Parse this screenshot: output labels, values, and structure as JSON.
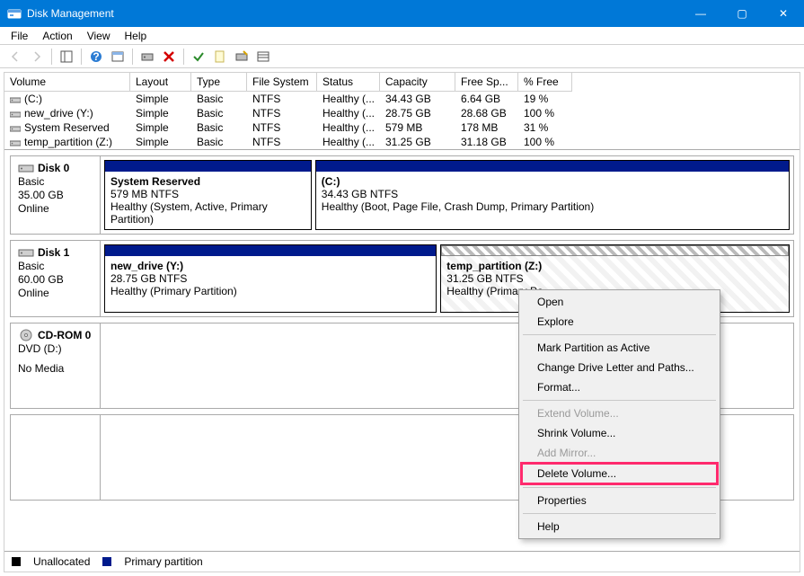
{
  "window": {
    "title": "Disk Management",
    "buttons": {
      "min": "—",
      "max": "▢",
      "close": "✕"
    }
  },
  "menus": [
    "File",
    "Action",
    "View",
    "Help"
  ],
  "toolbar_icons": [
    "back",
    "forward",
    "|",
    "show-hide",
    "|",
    "help-icon",
    "properties-icon",
    "|",
    "refresh-icon",
    "delete-icon",
    "|",
    "check-icon",
    "note-icon",
    "wizard-icon",
    "list-icon"
  ],
  "columns": {
    "volume": "Volume",
    "layout": "Layout",
    "type": "Type",
    "fs": "File System",
    "status": "Status",
    "capacity": "Capacity",
    "free": "Free Sp...",
    "pct": "% Free"
  },
  "volumes": [
    {
      "name": "(C:)",
      "layout": "Simple",
      "type": "Basic",
      "fs": "NTFS",
      "status": "Healthy (...",
      "capacity": "34.43 GB",
      "free": "6.64 GB",
      "pct": "19 %"
    },
    {
      "name": "new_drive (Y:)",
      "layout": "Simple",
      "type": "Basic",
      "fs": "NTFS",
      "status": "Healthy (...",
      "capacity": "28.75 GB",
      "free": "28.68 GB",
      "pct": "100 %"
    },
    {
      "name": "System Reserved",
      "layout": "Simple",
      "type": "Basic",
      "fs": "NTFS",
      "status": "Healthy (...",
      "capacity": "579 MB",
      "free": "178 MB",
      "pct": "31 %"
    },
    {
      "name": "temp_partition (Z:)",
      "layout": "Simple",
      "type": "Basic",
      "fs": "NTFS",
      "status": "Healthy (...",
      "capacity": "31.25 GB",
      "free": "31.18 GB",
      "pct": "100 %"
    }
  ],
  "disks": [
    {
      "name": "Disk 0",
      "type": "Basic",
      "size": "35.00 GB",
      "state": "Online",
      "parts": [
        {
          "title": "System Reserved",
          "line2": "579 MB NTFS",
          "line3": "Healthy (System, Active, Primary Partition)",
          "flex": 1
        },
        {
          "title": " (C:)",
          "line2": "34.43 GB NTFS",
          "line3": "Healthy (Boot, Page File, Crash Dump, Primary Partition)",
          "flex": 2.3
        }
      ]
    },
    {
      "name": "Disk 1",
      "type": "Basic",
      "size": "60.00 GB",
      "state": "Online",
      "parts": [
        {
          "title": "new_drive  (Y:)",
          "line2": "28.75 GB  NTFS",
          "line3": "Healthy (Primary Partition)",
          "flex": 1
        },
        {
          "title": "temp_partition  (Z:)",
          "line2": "31.25 GB NTFS",
          "line3": "Healthy (Primary Pa",
          "flex": 1.05,
          "selected": true
        }
      ]
    }
  ],
  "cdrom": {
    "name": "CD-ROM 0",
    "type": "DVD (D:)",
    "state": "No Media"
  },
  "legend": {
    "unalloc": "Unallocated",
    "primary": "Primary partition"
  },
  "context_menu": {
    "open": "Open",
    "explore": "Explore",
    "mark_active": "Mark Partition as Active",
    "change_letter": "Change Drive Letter and Paths...",
    "format": "Format...",
    "extend": "Extend Volume...",
    "shrink": "Shrink Volume...",
    "add_mirror": "Add Mirror...",
    "delete": "Delete Volume...",
    "properties": "Properties",
    "help": "Help"
  }
}
